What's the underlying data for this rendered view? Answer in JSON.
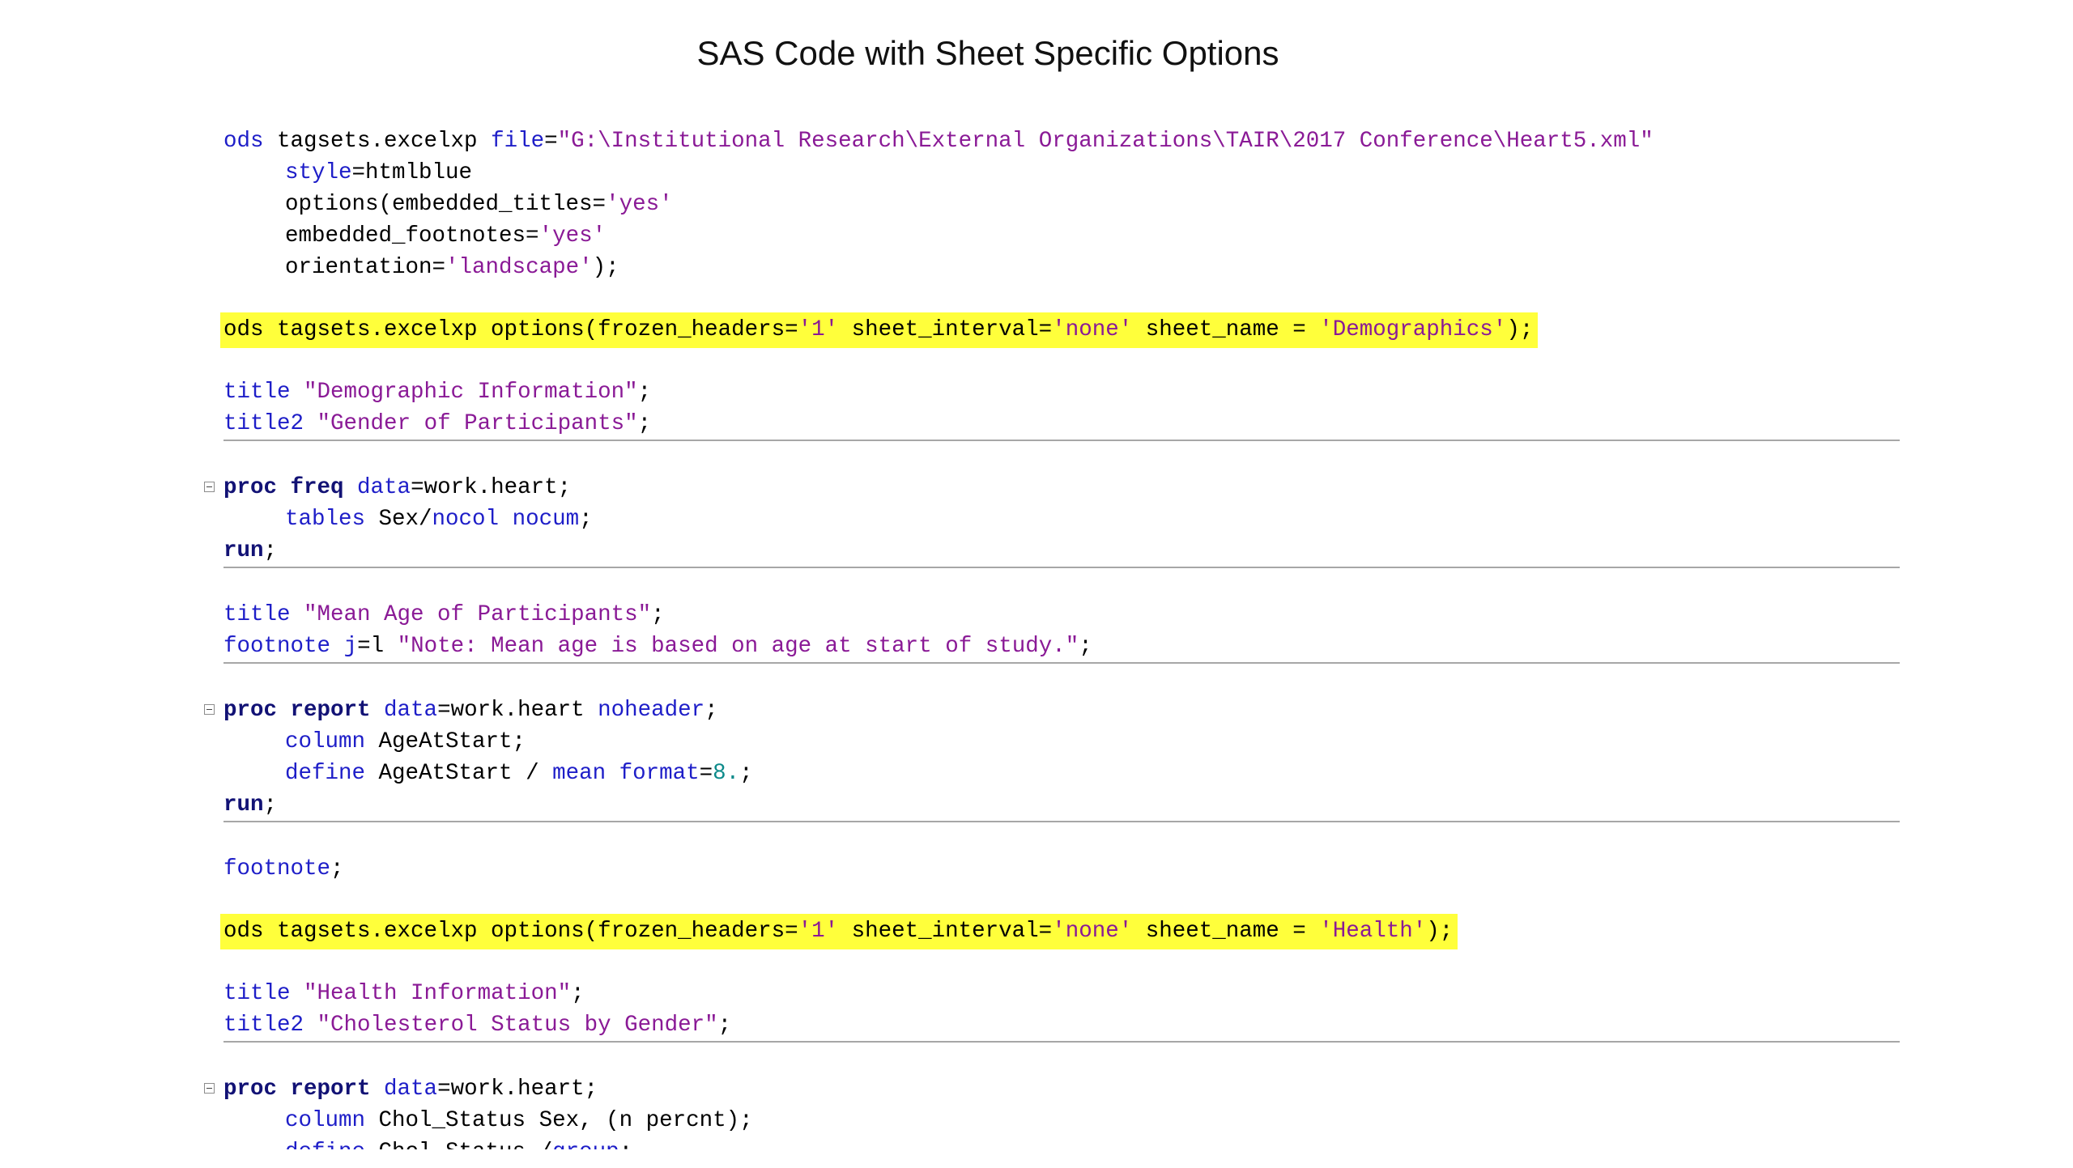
{
  "slide": {
    "title": "SAS Code with Sheet Specific Options"
  },
  "colors": {
    "keyword": "#1e1ec8",
    "proc_keyword": "#121275",
    "string": "#8a1a96",
    "number": "#0c8a8a",
    "highlight": "#ffff3b",
    "separator": "#a7a7a7"
  },
  "icons": {
    "collapse": "collapse-minus-icon"
  },
  "code": {
    "l1": [
      {
        "c": "kw",
        "t": "ods"
      },
      {
        "t": " tagsets.excelxp "
      },
      {
        "c": "kw",
        "t": "file"
      },
      {
        "t": "="
      },
      {
        "c": "str",
        "t": "\"G:\\Institutional Research\\External Organizations\\TAIR\\2017 Conference\\Heart5.xml\""
      }
    ],
    "l2": [
      {
        "c": "kw",
        "t": "style"
      },
      {
        "t": "=htmlblue"
      }
    ],
    "l3": [
      {
        "t": "options(embedded_titles="
      },
      {
        "c": "str",
        "t": "'yes'"
      }
    ],
    "l4": [
      {
        "t": "embedded_footnotes="
      },
      {
        "c": "str",
        "t": "'yes'"
      }
    ],
    "l5": [
      {
        "t": "orientation="
      },
      {
        "c": "str",
        "t": "'landscape'"
      },
      {
        "t": ");"
      }
    ],
    "l6": [
      {
        "t": "ods tagsets.excelxp options(frozen_headers="
      },
      {
        "c": "str",
        "t": "'1'"
      },
      {
        "t": " sheet_interval="
      },
      {
        "c": "str",
        "t": "'none'"
      },
      {
        "t": " sheet_name = "
      },
      {
        "c": "str",
        "t": "'Demographics'"
      },
      {
        "t": ");"
      }
    ],
    "l7": [
      {
        "c": "kw",
        "t": "title"
      },
      {
        "t": " "
      },
      {
        "c": "str",
        "t": "\"Demographic Information\""
      },
      {
        "t": ";"
      }
    ],
    "l8": [
      {
        "c": "kw",
        "t": "title2"
      },
      {
        "t": " "
      },
      {
        "c": "str",
        "t": "\"Gender of Participants\""
      },
      {
        "t": ";"
      }
    ],
    "l9": [
      {
        "c": "kwb",
        "t": "proc freq"
      },
      {
        "t": " "
      },
      {
        "c": "kw",
        "t": "data"
      },
      {
        "t": "=work.heart;"
      }
    ],
    "l10": [
      {
        "c": "kw",
        "t": "tables"
      },
      {
        "t": " Sex/"
      },
      {
        "c": "kw",
        "t": "nocol nocum"
      },
      {
        "t": ";"
      }
    ],
    "l11": [
      {
        "c": "kwb",
        "t": "run"
      },
      {
        "t": ";"
      }
    ],
    "l12": [
      {
        "c": "kw",
        "t": "title"
      },
      {
        "t": " "
      },
      {
        "c": "str",
        "t": "\"Mean Age of Participants\""
      },
      {
        "t": ";"
      }
    ],
    "l13": [
      {
        "c": "kw",
        "t": "footnote"
      },
      {
        "t": " "
      },
      {
        "c": "kw",
        "t": "j"
      },
      {
        "t": "=l "
      },
      {
        "c": "str",
        "t": "\"Note: Mean age is based on age at start of study.\""
      },
      {
        "t": ";"
      }
    ],
    "l14": [
      {
        "c": "kwb",
        "t": "proc report"
      },
      {
        "t": " "
      },
      {
        "c": "kw",
        "t": "data"
      },
      {
        "t": "=work.heart "
      },
      {
        "c": "kw",
        "t": "noheader"
      },
      {
        "t": ";"
      }
    ],
    "l15": [
      {
        "c": "kw",
        "t": "column"
      },
      {
        "t": " AgeAtStart;"
      }
    ],
    "l16": [
      {
        "c": "kw",
        "t": "define"
      },
      {
        "t": " AgeAtStart / "
      },
      {
        "c": "kw",
        "t": "mean"
      },
      {
        "t": " "
      },
      {
        "c": "kw",
        "t": "format"
      },
      {
        "t": "="
      },
      {
        "c": "num",
        "t": "8."
      },
      {
        "t": ";"
      }
    ],
    "l17": [
      {
        "c": "kwb",
        "t": "run"
      },
      {
        "t": ";"
      }
    ],
    "l18": [
      {
        "c": "kw",
        "t": "footnote"
      },
      {
        "t": ";"
      }
    ],
    "l19": [
      {
        "t": "ods tagsets.excelxp options(frozen_headers="
      },
      {
        "c": "str",
        "t": "'1'"
      },
      {
        "t": " sheet_interval="
      },
      {
        "c": "str",
        "t": "'none'"
      },
      {
        "t": " sheet_name = "
      },
      {
        "c": "str",
        "t": "'Health'"
      },
      {
        "t": ");"
      }
    ],
    "l20": [
      {
        "c": "kw",
        "t": "title"
      },
      {
        "t": " "
      },
      {
        "c": "str",
        "t": "\"Health Information\""
      },
      {
        "t": ";"
      }
    ],
    "l21": [
      {
        "c": "kw",
        "t": "title2"
      },
      {
        "t": " "
      },
      {
        "c": "str",
        "t": "\"Cholesterol Status by Gender\""
      },
      {
        "t": ";"
      }
    ],
    "l22": [
      {
        "c": "kwb",
        "t": "proc report"
      },
      {
        "t": " "
      },
      {
        "c": "kw",
        "t": "data"
      },
      {
        "t": "=work.heart;"
      }
    ],
    "l23": [
      {
        "c": "kw",
        "t": "column"
      },
      {
        "t": " Chol_Status Sex, (n percnt);"
      }
    ],
    "l24": [
      {
        "c": "kw",
        "t": "define"
      },
      {
        "t": " Chol_Status /"
      },
      {
        "c": "kw",
        "t": "group"
      },
      {
        "t": ";"
      }
    ]
  }
}
